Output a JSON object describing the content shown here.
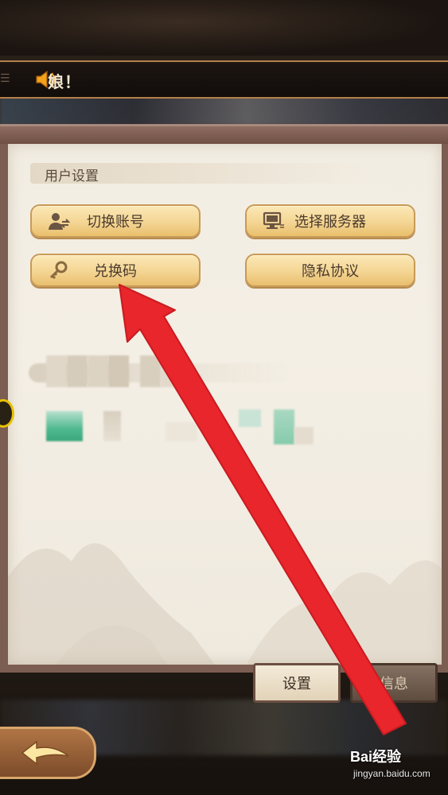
{
  "notice": {
    "text": "‌娘！",
    "icon": "speaker-icon"
  },
  "panel": {
    "section_title": "用户设置",
    "buttons": [
      {
        "label": "切换账号",
        "icon": "switch-account-icon"
      },
      {
        "label": "选择服务器",
        "icon": "server-icon"
      },
      {
        "label": "兑换码",
        "icon": "key-icon"
      },
      {
        "label": "隐私协议",
        "icon": ""
      }
    ]
  },
  "tabs": {
    "settings": "设置",
    "info": "信息"
  },
  "back": {
    "icon": "back-arrow-icon"
  },
  "watermark": {
    "brand": "Bai经验",
    "url": "jingyan.baidu.com"
  },
  "colors": {
    "button_fill": "#f4d593",
    "button_border": "#c89a58",
    "panel_bg": "#f2ede3",
    "frame": "#7c5d52",
    "annotation_arrow": "#e8262b"
  }
}
